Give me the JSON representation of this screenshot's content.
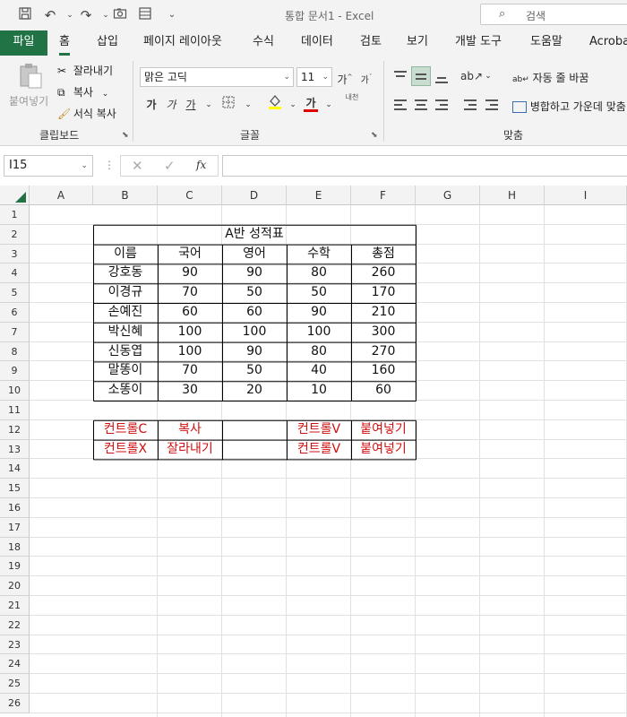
{
  "titlebar": {
    "doc_title": "통합 문서1  -  Excel",
    "search_placeholder": "검색"
  },
  "tabs": [
    "파일",
    "홈",
    "삽입",
    "페이지 레이아웃",
    "수식",
    "데이터",
    "검토",
    "보기",
    "개발 도구",
    "도움말",
    "Acrobat"
  ],
  "clipboard": {
    "paste_label": "붙여넣기",
    "cut_label": "잘라내기",
    "copy_label": "복사",
    "format_painter_label": "서식 복사",
    "group_label": "클립보드"
  },
  "font": {
    "name": "맑은 고딕",
    "size": "11",
    "grow": "가",
    "shrink": "가",
    "bold": "가",
    "italic": "가",
    "underline": "가",
    "font_color_glyph": "가",
    "phonetic": "내천",
    "group_label": "글꼴",
    "highlight_color": "#ffff00",
    "font_color": "#e00000"
  },
  "alignment": {
    "wrap_text_label": "자동 줄 바꿈",
    "merge_center_label": "병합하고 가운데 맞춤",
    "group_label": "맞춤"
  },
  "formula_bar": {
    "name_box": "I15",
    "fx": "fx",
    "formula": ""
  },
  "sheet": {
    "columns": [
      "A",
      "B",
      "C",
      "D",
      "E",
      "F",
      "G",
      "H",
      "I"
    ],
    "rows": [
      "1",
      "2",
      "3",
      "4",
      "5",
      "6",
      "7",
      "8",
      "9",
      "10",
      "11",
      "12",
      "13",
      "14",
      "15",
      "16",
      "17",
      "18",
      "19",
      "20",
      "21",
      "22",
      "23",
      "24",
      "25",
      "26"
    ],
    "title": "A반 성적표",
    "headers": [
      "이름",
      "국어",
      "영어",
      "수학",
      "총점"
    ],
    "students": [
      [
        "강호동",
        "90",
        "90",
        "80",
        "260"
      ],
      [
        "이경규",
        "70",
        "50",
        "50",
        "170"
      ],
      [
        "손예진",
        "60",
        "60",
        "90",
        "210"
      ],
      [
        "박신혜",
        "100",
        "100",
        "100",
        "300"
      ],
      [
        "신동엽",
        "100",
        "90",
        "80",
        "270"
      ],
      [
        "말똥이",
        "70",
        "50",
        "40",
        "160"
      ],
      [
        "소똥이",
        "30",
        "20",
        "10",
        "60"
      ]
    ],
    "shortcuts": [
      [
        "컨트롤C",
        "복사",
        "",
        "컨트롤V",
        "붙여넣기"
      ],
      [
        "컨트롤X",
        "잘라내기",
        "",
        "컨트롤V",
        "붙여넣기"
      ]
    ],
    "accent_color": "#217346",
    "red_text_color": "#d01010"
  }
}
